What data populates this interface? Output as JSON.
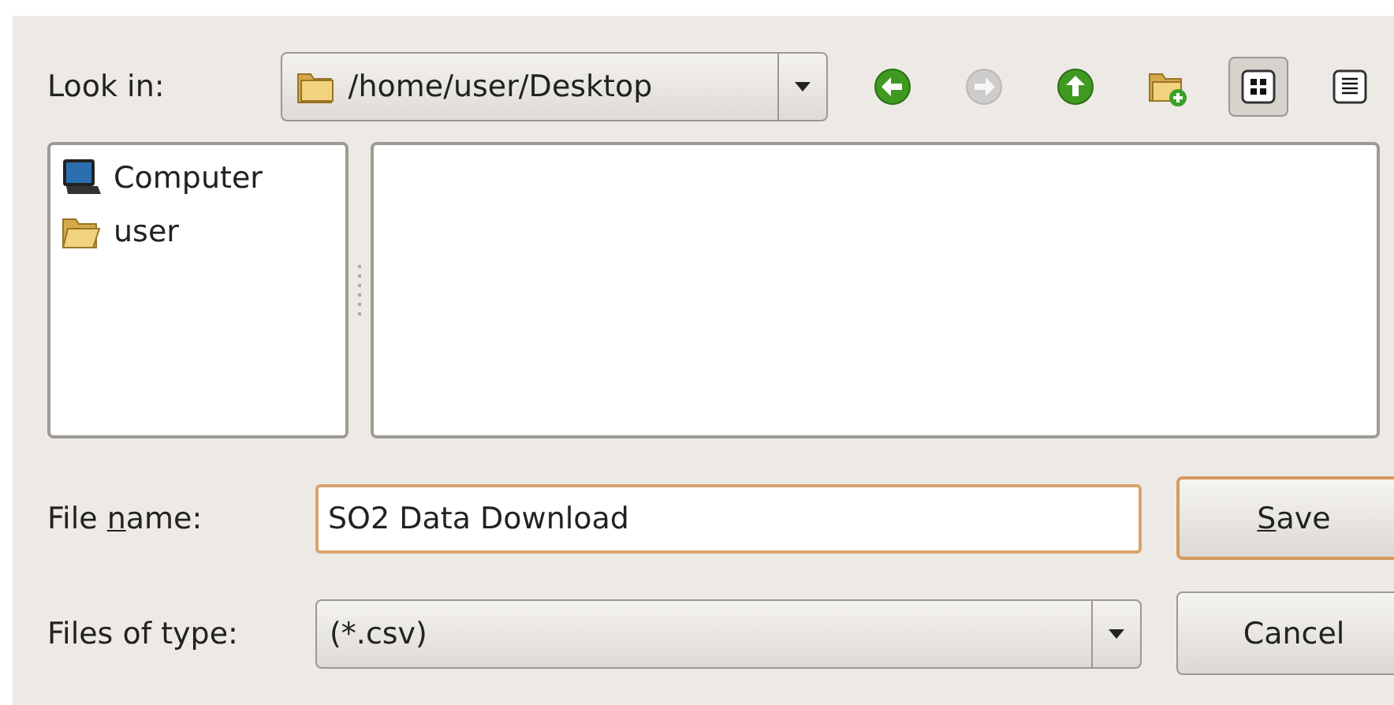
{
  "look_in": {
    "label": "Look in:",
    "path": "/home/user/Desktop"
  },
  "toolbar": [
    {
      "kind": "back",
      "disabled": false
    },
    {
      "kind": "forward",
      "disabled": true
    },
    {
      "kind": "up",
      "disabled": false
    },
    {
      "kind": "new-folder",
      "disabled": false
    }
  ],
  "views": [
    {
      "kind": "icons",
      "selected": true
    },
    {
      "kind": "list",
      "selected": false
    }
  ],
  "sidebar": {
    "items": [
      {
        "kind": "computer",
        "label": "Computer"
      },
      {
        "kind": "folder",
        "label": "user"
      }
    ]
  },
  "file_name": {
    "label": {
      "pre": "File ",
      "key": "n",
      "post": "ame:"
    },
    "value": "SO2 Data Download"
  },
  "file_type": {
    "label": "Files of type:",
    "value": "(*.csv)"
  },
  "buttons": [
    {
      "label": {
        "key": "S",
        "post": "ave"
      },
      "default": true
    },
    {
      "label": {
        "pre": "Cancel"
      },
      "default": false
    }
  ]
}
